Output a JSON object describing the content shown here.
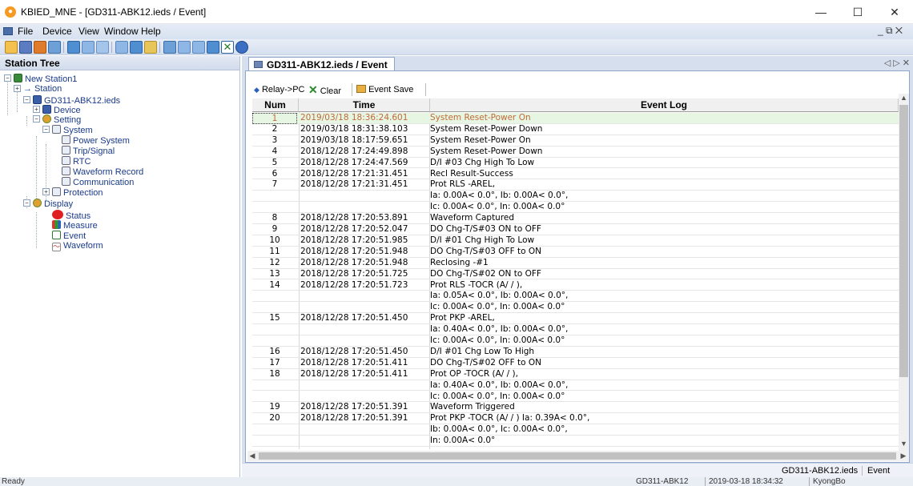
{
  "window": {
    "title": "KBIED_MNE - [GD311-ABK12.ieds / Event]",
    "controls": {
      "minimize": "—",
      "maximize": "☐",
      "close": "✕"
    }
  },
  "menu": {
    "items": [
      "File",
      "Device",
      "View",
      "Window",
      "Help"
    ],
    "mdi_controls": "_ ⧉ ✕"
  },
  "toolbar": {
    "icons": [
      "open-icon",
      "save-icon",
      "connect-icon",
      "network-icon",
      "list-icon",
      "send-icon",
      "receive-icon",
      "relay-icon",
      "monitor-icon",
      "grid-icon",
      "window-icon",
      "tile-icon",
      "cascade-icon",
      "filter-icon",
      "close-icon",
      "about-icon"
    ]
  },
  "station_tree": {
    "header": "Station Tree",
    "nodes": {
      "root": "New Station1",
      "station": "Station",
      "ied": "GD311-ABK12.ieds",
      "device": "Device",
      "setting": "Setting",
      "system": "System",
      "power_system": "Power System",
      "trip_signal": "Trip/Signal",
      "rtc": "RTC",
      "waveform_record": "Waveform Record",
      "communication": "Communication",
      "protection": "Protection",
      "display": "Display",
      "status": "Status",
      "measure": "Measure",
      "event": "Event",
      "waveform": "Waveform"
    }
  },
  "tab": {
    "label": "GD311-ABK12.ieds / Event",
    "nav": "◁ ▷ ✕"
  },
  "event_toolbar": {
    "relay_pc": "Relay->PC",
    "clear": "Clear",
    "event_save": "Event Save"
  },
  "grid": {
    "headers": {
      "num": "Num",
      "time": "Time",
      "log": "Event Log"
    },
    "rows": [
      {
        "num": "1",
        "time": "2019/03/18 18:36:24.601",
        "log": "System Reset-Power On",
        "selected": true
      },
      {
        "num": "2",
        "time": "2019/03/18 18:31:38.103",
        "log": "System Reset-Power Down"
      },
      {
        "num": "3",
        "time": "2019/03/18 18:17:59.651",
        "log": "System Reset-Power On"
      },
      {
        "num": "4",
        "time": "2018/12/28 17:24:49.898",
        "log": "System Reset-Power Down"
      },
      {
        "num": "5",
        "time": "2018/12/28 17:24:47.569",
        "log": "D/I #03 Chg High To Low"
      },
      {
        "num": "6",
        "time": "2018/12/28 17:21:31.451",
        "log": "Recl Result-Success"
      },
      {
        "num": "7",
        "time": "2018/12/28 17:21:31.451",
        "log": "Prot RLS -AREL,"
      },
      {
        "num": "",
        "time": "",
        "log": "Ia: 0.00A< 0.0°, Ib: 0.00A< 0.0°,"
      },
      {
        "num": "",
        "time": "",
        "log": "Ic: 0.00A< 0.0°, In: 0.00A< 0.0°"
      },
      {
        "num": "8",
        "time": "2018/12/28 17:20:53.891",
        "log": "Waveform Captured"
      },
      {
        "num": "9",
        "time": "2018/12/28 17:20:52.047",
        "log": "DO Chg-T/S#03 ON to OFF"
      },
      {
        "num": "10",
        "time": "2018/12/28 17:20:51.985",
        "log": "D/I #01 Chg High To Low"
      },
      {
        "num": "11",
        "time": "2018/12/28 17:20:51.948",
        "log": "DO Chg-T/S#03 OFF to ON"
      },
      {
        "num": "12",
        "time": "2018/12/28 17:20:51.948",
        "log": "Reclosing  -#1"
      },
      {
        "num": "13",
        "time": "2018/12/28 17:20:51.725",
        "log": "DO Chg-T/S#02 ON to OFF"
      },
      {
        "num": "14",
        "time": "2018/12/28 17:20:51.723",
        "log": "Prot RLS -TOCR  (A/ / ),"
      },
      {
        "num": "",
        "time": "",
        "log": "Ia: 0.05A< 0.0°, Ib: 0.00A< 0.0°,"
      },
      {
        "num": "",
        "time": "",
        "log": "Ic: 0.00A< 0.0°, In: 0.00A< 0.0°"
      },
      {
        "num": "15",
        "time": "2018/12/28 17:20:51.450",
        "log": "Prot PKP -AREL,"
      },
      {
        "num": "",
        "time": "",
        "log": "Ia: 0.40A< 0.0°, Ib: 0.00A< 0.0°,"
      },
      {
        "num": "",
        "time": "",
        "log": "Ic: 0.00A< 0.0°, In: 0.00A< 0.0°"
      },
      {
        "num": "16",
        "time": "2018/12/28 17:20:51.450",
        "log": "D/I #01 Chg Low To High"
      },
      {
        "num": "17",
        "time": "2018/12/28 17:20:51.411",
        "log": "DO Chg-T/S#02 OFF to ON"
      },
      {
        "num": "18",
        "time": "2018/12/28 17:20:51.411",
        "log": "Prot OP  -TOCR  (A/ / ),"
      },
      {
        "num": "",
        "time": "",
        "log": "Ia: 0.40A< 0.0°, Ib: 0.00A< 0.0°,"
      },
      {
        "num": "",
        "time": "",
        "log": "Ic: 0.00A< 0.0°, In: 0.00A< 0.0°"
      },
      {
        "num": "19",
        "time": "2018/12/28 17:20:51.391",
        "log": "Waveform Triggered"
      },
      {
        "num": "20",
        "time": "2018/12/28 17:20:51.391",
        "log": "Prot PKP -TOCR  (A/ / ) Ia:  0.39A< 0.0°,"
      },
      {
        "num": "",
        "time": "",
        "log": "Ib: 0.00A< 0.0°, Ic: 0.00A< 0.0°,"
      },
      {
        "num": "",
        "time": "",
        "log": "In: 0.00A< 0.0°"
      }
    ]
  },
  "doc_status": {
    "file": "GD311-ABK12.ieds",
    "view": "Event"
  },
  "status_bar": {
    "left": "Ready",
    "device": "GD311-ABK12",
    "datetime": "2019-03-18 18:34:32",
    "user": "KyongBo"
  },
  "colors": {
    "selected_row_bg": "#e7f6e3",
    "selected_row_text": "#c06a3a",
    "chrome": "#d5dfee",
    "tree_text": "#1a3a8a"
  }
}
